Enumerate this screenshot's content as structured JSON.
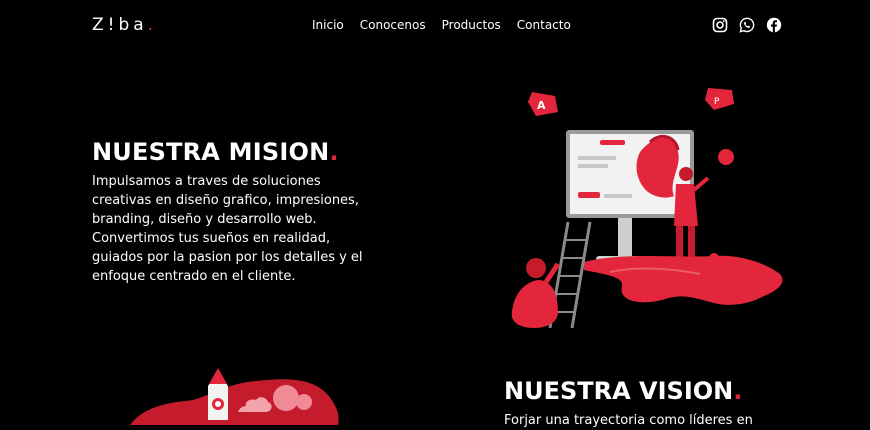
{
  "brand": {
    "logo_text": "Z!ba",
    "accent_color": "#e3263b"
  },
  "nav": {
    "items": [
      "Inicio",
      "Conocenos",
      "Productos",
      "Contacto"
    ]
  },
  "social": [
    "instagram-icon",
    "whatsapp-icon",
    "facebook-icon"
  ],
  "mission": {
    "title": "NUESTRA MISION",
    "text": "Impulsamos a traves de soluciones creativas en diseño grafico, impresiones, branding, diseño y desarrollo web. Convertimos tus sueños en realidad, guiados por la pasion por los detalles y el enfoque centrado en el cliente."
  },
  "vision": {
    "title": "NUESTRA VISION",
    "text": "Forjar una trayectoria como líderes en"
  }
}
